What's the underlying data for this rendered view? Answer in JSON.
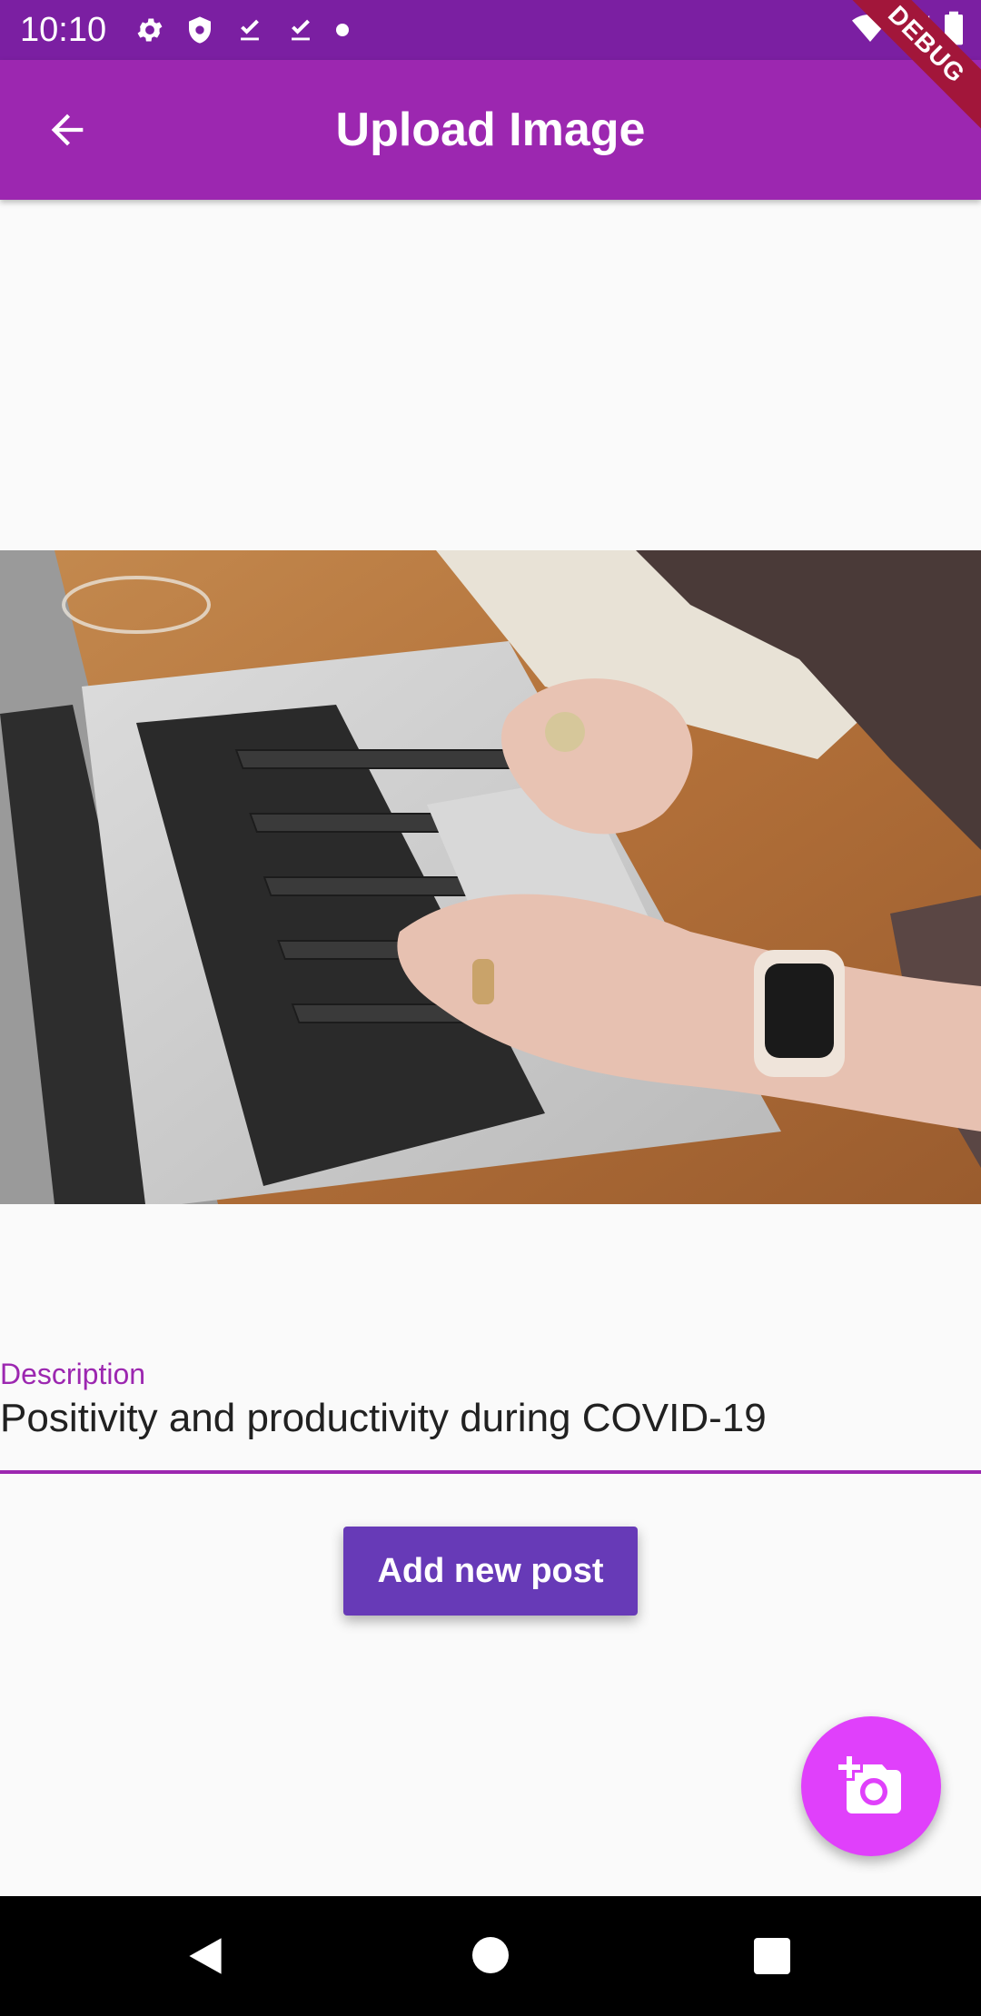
{
  "status_bar": {
    "time": "10:10",
    "icons": [
      "gear-icon",
      "shield-icon",
      "download-done-icon",
      "download-done-icon",
      "dot-icon",
      "wifi-icon",
      "signal-icon",
      "battery-icon"
    ]
  },
  "app_bar": {
    "title": "Upload Image",
    "back_icon": "arrow-back-icon"
  },
  "debug_banner": "DEBUG",
  "image": {
    "subject": "laptop-typing-photo"
  },
  "form": {
    "description_label": "Description",
    "description_value": "Positivity and productivity during COVID-19"
  },
  "add_button_label": "Add new post",
  "fab_icon": "add-photo-camera-icon",
  "colors": {
    "status_bar": "#7b1fa2",
    "app_bar": "#9c27b0",
    "accent": "#9c27b0",
    "button": "#673ab7",
    "fab": "#e040fb"
  }
}
